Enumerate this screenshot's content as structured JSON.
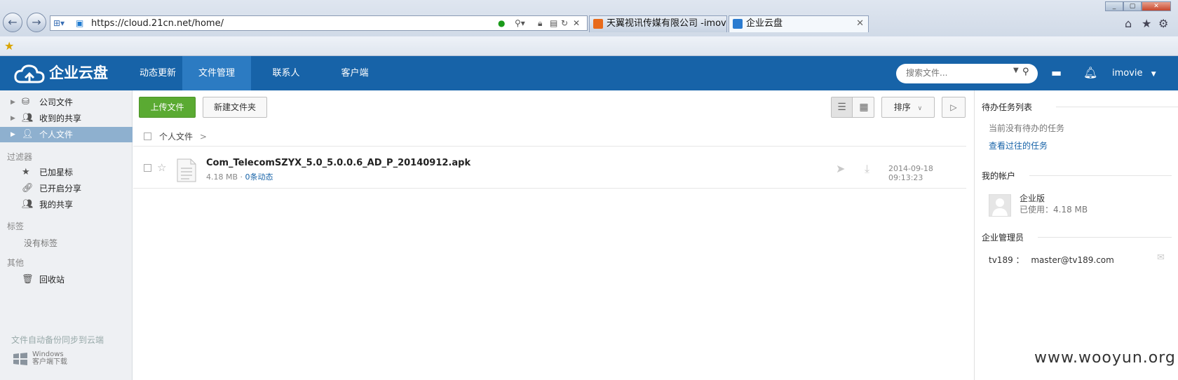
{
  "browser": {
    "url": "https://cloud.21cn.net/home/",
    "tabs": [
      {
        "label": "天翼视讯传媒有限公司 -imovi...",
        "favicon": "189-icon"
      },
      {
        "label": "企业云盘",
        "favicon": "cloud-icon"
      }
    ]
  },
  "header": {
    "logo_text": "企业云盘",
    "nav": [
      "动态更新",
      "文件管理",
      "联系人",
      "客户端"
    ],
    "active_nav": "文件管理",
    "search_placeholder": "搜索文件...",
    "username": "imovie",
    "colors": {
      "brand": "#1763a8",
      "active_nav": "#2c7bc2"
    }
  },
  "sidebar": {
    "items": [
      {
        "label": "公司文件",
        "icon": "drive-icon"
      },
      {
        "label": "收到的共享",
        "icon": "users-icon"
      },
      {
        "label": "个人文件",
        "icon": "user-icon",
        "active": true
      }
    ],
    "filter_title": "过滤器",
    "filters": [
      {
        "label": "已加星标",
        "icon": "star-icon"
      },
      {
        "label": "已开启分享",
        "icon": "link-icon"
      },
      {
        "label": "我的共享",
        "icon": "users-icon"
      }
    ],
    "tags_title": "标签",
    "tags_empty": "没有标签",
    "other_title": "其他",
    "recycle": "回收站",
    "sync_note": "文件自动备份同步到云端",
    "windows_client_line1": "Windows",
    "windows_client_line2": "客户端下载"
  },
  "toolbar": {
    "upload": "上传文件",
    "new_folder": "新建文件夹",
    "sort": "排序",
    "upload_color": "#5aaa32"
  },
  "breadcrumb": {
    "label": "个人文件",
    "sep": ">"
  },
  "files": [
    {
      "name": "Com_TelecomSZYX_5.0_5.0.0.6_AD_P_20140912.apk",
      "size": "4.18 MB",
      "sep": "·",
      "activity": "0条动态",
      "date": "2014-09-18 09:13:23"
    }
  ],
  "right_panel": {
    "tasks_title": "待办任务列表",
    "tasks_empty": "当前没有待办的任务",
    "tasks_link": "查看过往的任务",
    "account_title": "我的帐户",
    "account_plan": "企业版",
    "account_used": "已使用：4.18 MB",
    "admin_title": "企业管理员",
    "admin_name": "tv189 ：",
    "admin_email": "master@tv189.com"
  },
  "watermark": "www.wooyun.org"
}
